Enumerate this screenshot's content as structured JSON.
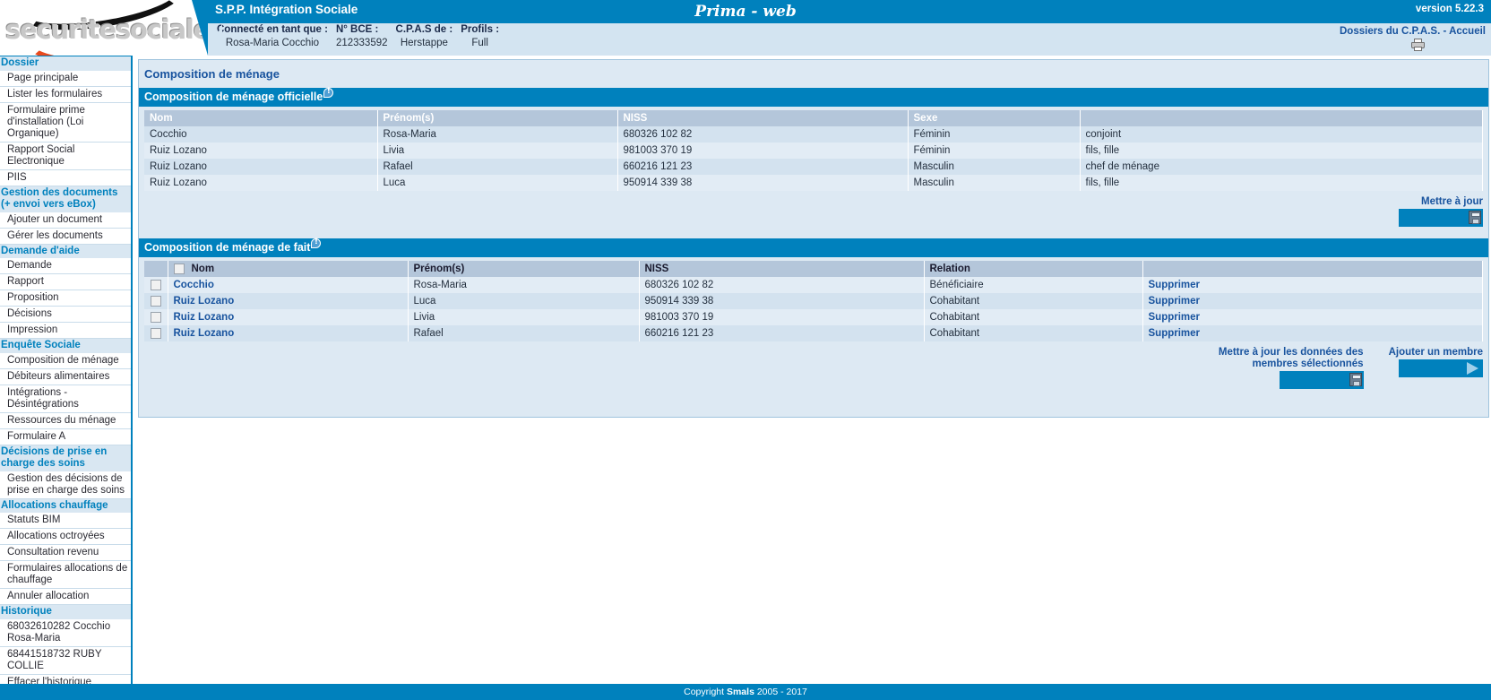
{
  "header": {
    "logo_text": "securitesociale.be",
    "app_subtitle": "S.P.P. Intégration Sociale",
    "app_title": "Prima - web",
    "version": "version 5.22.3",
    "user_fields": [
      {
        "label": "Connecté en tant que :",
        "value": "Rosa-Maria Cocchio"
      },
      {
        "label": "N° BCE :",
        "value": "212333592"
      },
      {
        "label": "C.P.A.S de :",
        "value": "Herstappe"
      },
      {
        "label": "Profils :",
        "value": "Full"
      }
    ],
    "breadcrumb_1": "Dossiers du C.P.A.S.",
    "breadcrumb_sep": " - ",
    "breadcrumb_2": "Accueil",
    "print_icon": "printer-icon"
  },
  "sidebar": {
    "groups": [
      {
        "title": "Dossier",
        "items": [
          "Page principale",
          "Lister les formulaires",
          "Formulaire prime d'installation (Loi Organique)",
          "Rapport Social Electronique",
          "PIIS"
        ]
      },
      {
        "title": "Gestion des documents (+ envoi vers eBox)",
        "items": [
          "Ajouter un document",
          "Gérer les documents"
        ]
      },
      {
        "title": "Demande d'aide",
        "items": [
          "Demande",
          "Rapport",
          "Proposition",
          "Décisions",
          "Impression"
        ]
      },
      {
        "title": "Enquête Sociale",
        "items": [
          "Composition de ménage",
          "Débiteurs alimentaires",
          "Intégrations - Désintégrations",
          "Ressources du ménage",
          "Formulaire A"
        ]
      },
      {
        "title": "Décisions de prise en charge des soins",
        "items": [
          "Gestion des décisions de prise en charge des soins"
        ]
      },
      {
        "title": "Allocations chauffage",
        "items": [
          "Statuts BIM",
          "Allocations octroyées",
          "Consultation revenu",
          "Formulaires allocations de chauffage",
          "Annuler allocation"
        ]
      },
      {
        "title": "Historique",
        "items": [
          "68032610282 Cocchio Rosa-Maria",
          "68441518732 RUBY COLLIE",
          "Effacer l'historique"
        ]
      }
    ]
  },
  "main": {
    "page_title": "Composition de ménage",
    "official": {
      "section_title": "Composition de ménage officielle",
      "info_icon": "info-icon",
      "columns": [
        "Nom",
        "Prénom(s)",
        "NISS",
        "Sexe",
        ""
      ],
      "rows": [
        {
          "nom": "Cocchio",
          "prenom": "Rosa-Maria",
          "niss": "680326 102 82",
          "sexe": "Féminin",
          "relation": "conjoint"
        },
        {
          "nom": "Ruiz Lozano",
          "prenom": "Livia",
          "niss": "981003 370 19",
          "sexe": "Féminin",
          "relation": "fils, fille"
        },
        {
          "nom": "Ruiz Lozano",
          "prenom": "Rafael",
          "niss": "660216 121 23",
          "sexe": "Masculin",
          "relation": "chef de ménage"
        },
        {
          "nom": "Ruiz Lozano",
          "prenom": "Luca",
          "niss": "950914 339 38",
          "sexe": "Masculin",
          "relation": "fils, fille"
        }
      ],
      "update_label": "Mettre à jour",
      "update_icon": "save-icon"
    },
    "defacto": {
      "section_title": "Composition de ménage de fait",
      "info_icon": "info-icon",
      "columns": [
        "",
        "Nom",
        "Prénom(s)",
        "NISS",
        "Relation",
        ""
      ],
      "rows": [
        {
          "nom": "Cocchio",
          "prenom": "Rosa-Maria",
          "niss": "680326 102 82",
          "relation": "Bénéficiaire",
          "action": "Supprimer",
          "checked": false
        },
        {
          "nom": "Ruiz Lozano",
          "prenom": "Luca",
          "niss": "950914 339 38",
          "relation": "Cohabitant",
          "action": "Supprimer",
          "checked": false
        },
        {
          "nom": "Ruiz Lozano",
          "prenom": "Livia",
          "niss": "981003 370 19",
          "relation": "Cohabitant",
          "action": "Supprimer",
          "checked": false
        },
        {
          "nom": "Ruiz Lozano",
          "prenom": "Rafael",
          "niss": "660216 121 23",
          "relation": "Cohabitant",
          "action": "Supprimer",
          "checked": false
        }
      ],
      "update_selected_label": "Mettre à jour les données des membres sélectionnés",
      "update_selected_icon": "save-icon",
      "add_member_label": "Ajouter un membre",
      "add_member_icon": "arrow-right-icon"
    }
  },
  "footer": {
    "copyright_prefix": "Copyright ",
    "copyright_brand": "Smals",
    "copyright_suffix": " 2005 - 2017"
  },
  "colors": {
    "brand_blue": "#0081bd",
    "link_blue": "#18539e",
    "panel_bg": "#dde9f3",
    "header_row": "#b4c6da",
    "row_odd": "#d3e2ef",
    "row_even": "#e2ecf5",
    "logo_orange": "#e8491d"
  }
}
